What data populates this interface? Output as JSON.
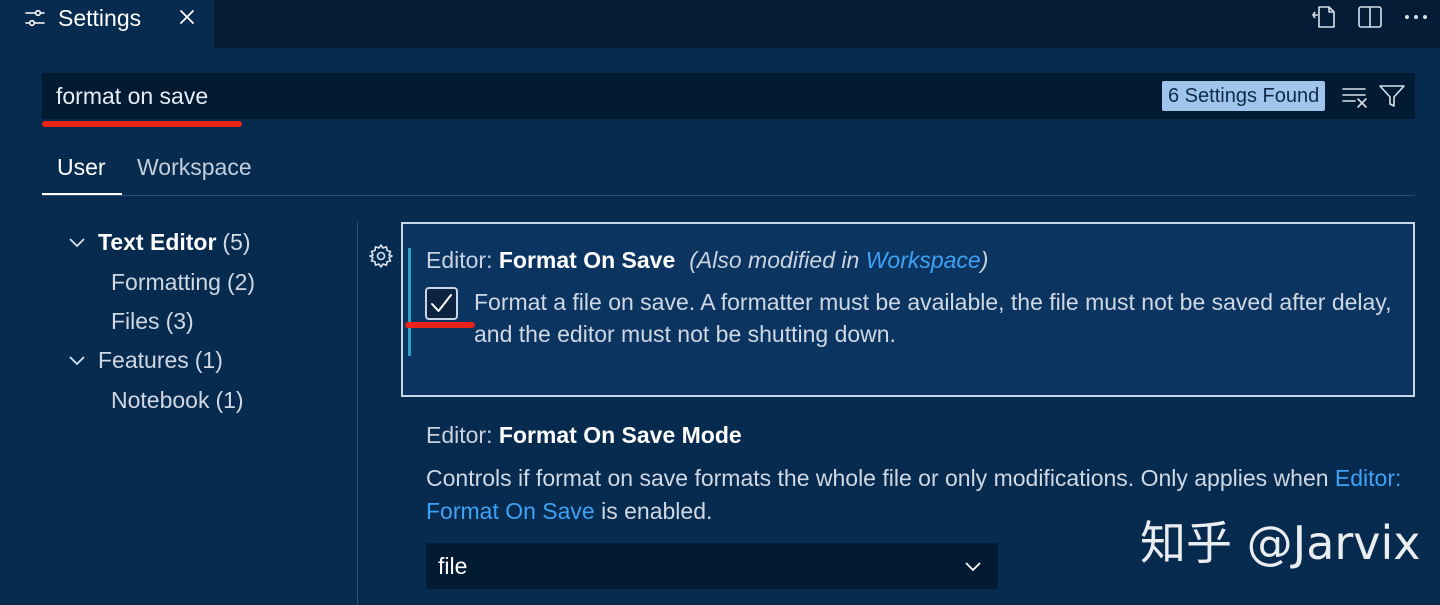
{
  "tab": {
    "title": "Settings",
    "icon": "settings-sliders-icon"
  },
  "toolbar": {
    "actions": [
      "open-settings-json-icon",
      "split-editor-icon",
      "more-actions-icon"
    ]
  },
  "search": {
    "value": "format on save",
    "results_label": "6 Settings Found"
  },
  "scopes": {
    "user": "User",
    "workspace": "Workspace",
    "active": "User"
  },
  "tree": {
    "items": [
      {
        "label": "Text Editor",
        "count": "(5)",
        "expanded": true
      },
      {
        "label": "Formatting",
        "count": "(2)"
      },
      {
        "label": "Files",
        "count": "(3)"
      },
      {
        "label": "Features",
        "count": "(1)",
        "expanded": true
      },
      {
        "label": "Notebook",
        "count": "(1)"
      }
    ]
  },
  "settings": {
    "format_on_save": {
      "category": "Editor: ",
      "name": "Format On Save",
      "modified_prefix": "(Also modified in ",
      "modified_link": "Workspace",
      "modified_suffix": ")",
      "checked": true,
      "description": "Format a file on save. A formatter must be available, the file must not be saved after delay, and the editor must not be shutting down."
    },
    "format_on_save_mode": {
      "category": "Editor: ",
      "name": "Format On Save Mode",
      "description_before": "Controls if format on save formats the whole file or only modifications. Only applies when ",
      "description_link": "Editor: Format On Save",
      "description_after": " is enabled.",
      "value": "file"
    }
  },
  "watermark": "知乎 @Jarvix",
  "colors": {
    "background": "#072a4f",
    "link": "#3ea2f5",
    "annotation": "#e8231a",
    "badge": "#9fc5ec"
  }
}
